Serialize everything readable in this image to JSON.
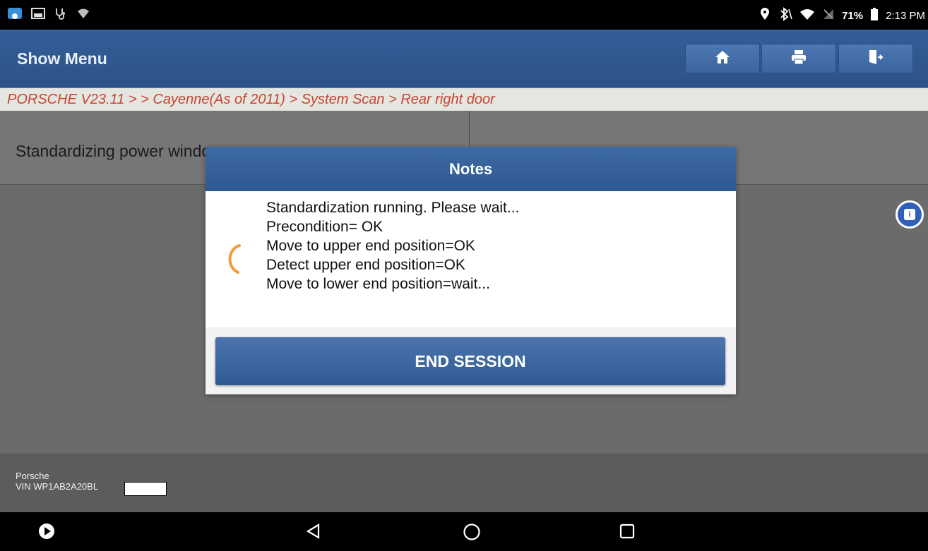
{
  "status_bar": {
    "battery_percent": "71%",
    "time": "2:13 PM",
    "left_icons": [
      "app-icon",
      "image-icon",
      "stethoscope-icon",
      "wifi-unknown-icon"
    ],
    "right_icons": [
      "location-icon",
      "bluetooth-icon",
      "wifi-icon",
      "no-signal-icon",
      "battery-icon"
    ]
  },
  "header": {
    "title": "Show Menu",
    "buttons": [
      "home-icon",
      "print-icon",
      "exit-icon"
    ]
  },
  "breadcrumb": "PORSCHE V23.11 > > Cayenne(As of 2011) > System Scan > Rear right door",
  "content": {
    "row_label": "Standardizing power windows"
  },
  "dialog": {
    "title": "Notes",
    "lines": [
      "Standardization running. Please wait...",
      "Precondition= OK",
      "Move to upper end position=OK",
      "Detect upper end position=OK",
      "Move to lower end position=wait..."
    ],
    "button_label": "END SESSION"
  },
  "footer": {
    "make": "Porsche",
    "vin": "VIN WP1AB2A20BL"
  },
  "colors": {
    "header": "#2f5890",
    "breadcrumb_text": "#c84434",
    "spinner": "#f39a3c",
    "button": "#3d67a2"
  }
}
